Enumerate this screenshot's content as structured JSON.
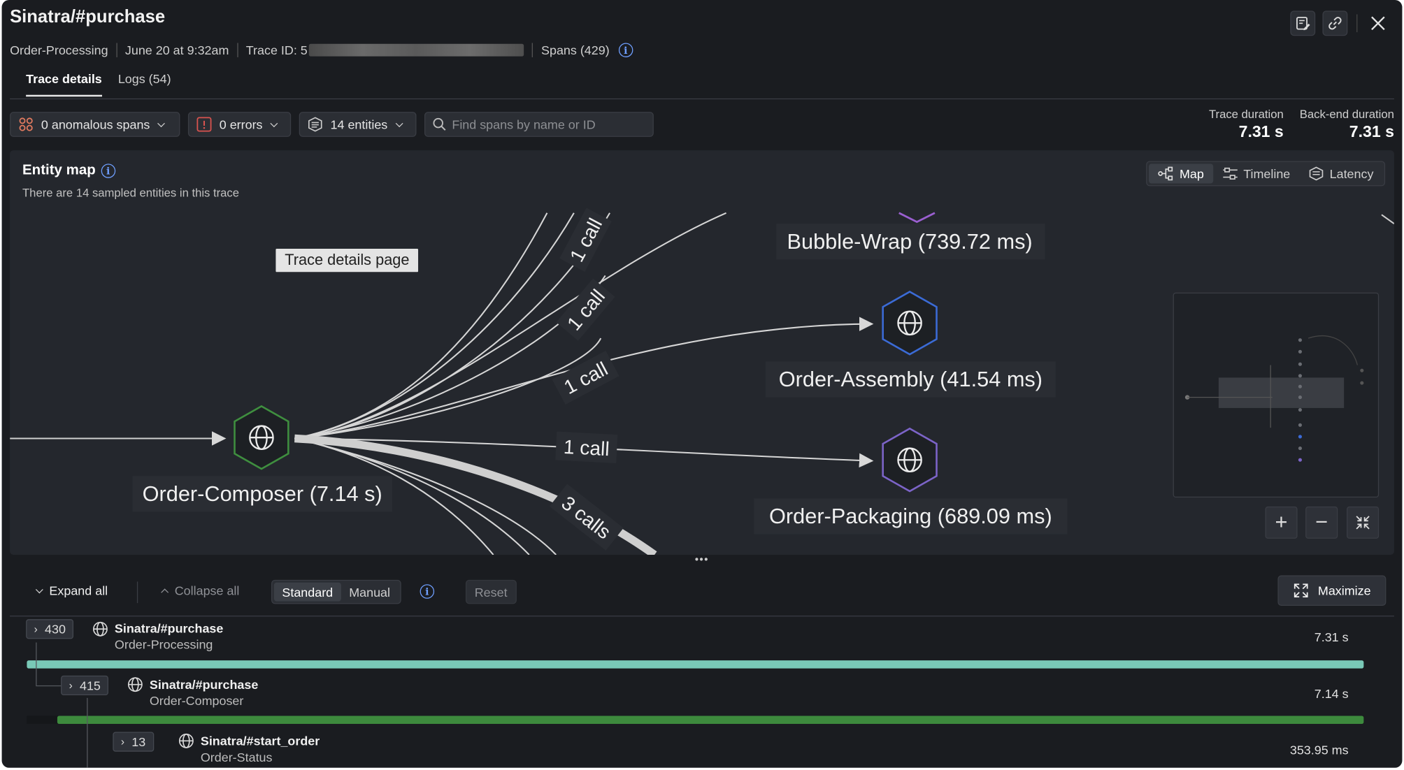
{
  "header": {
    "title": "Sinatra/#purchase",
    "service": "Order-Processing",
    "timestamp": "June 20 at 9:32am",
    "trace_id_label": "Trace ID: 5",
    "spans": "Spans (429)"
  },
  "tabs": [
    {
      "label": "Trace details",
      "active": true
    },
    {
      "label": "Logs (54)",
      "active": false
    }
  ],
  "filters": {
    "anomalous": "0 anomalous spans",
    "errors": "0 errors",
    "entities": "14 entities",
    "search_placeholder": "Find spans by name or ID"
  },
  "durations": {
    "trace_label": "Trace duration",
    "trace_value": "7.31 s",
    "backend_label": "Back-end duration",
    "backend_value": "7.31 s"
  },
  "entity_map": {
    "title": "Entity map",
    "subtitle": "There are 14 sampled entities in this trace",
    "views": [
      "Map",
      "Timeline",
      "Latency"
    ],
    "active_view": "Map",
    "tooltip": "Trace details page",
    "nodes": [
      {
        "label": "Order-Composer (7.14 s)",
        "color": "#3f8f3f"
      },
      {
        "label": "Bubble-Wrap (739.72 ms)",
        "color": "#9a5fd0"
      },
      {
        "label": "Order-Assembly (41.54 ms)",
        "color": "#3b6bd6"
      },
      {
        "label": "Order-Packaging (689.09 ms)",
        "color": "#7c64c8"
      }
    ],
    "edge_labels": [
      "1 call",
      "1 call",
      "1 call",
      "1 call",
      "3 calls"
    ]
  },
  "tree_controls": {
    "expand_all": "Expand all",
    "collapse_all": "Collapse all",
    "modes": [
      "Standard",
      "Manual"
    ],
    "active_mode": "Standard",
    "reset": "Reset",
    "maximize": "Maximize"
  },
  "spans": [
    {
      "count": "430",
      "name": "Sinatra/#purchase",
      "service": "Order-Processing",
      "duration": "7.31 s",
      "bar_color": "#79c9b7",
      "bar_start": 0.0,
      "bar_fraction": 1.0
    },
    {
      "count": "415",
      "name": "Sinatra/#purchase",
      "service": "Order-Composer",
      "duration": "7.14 s",
      "bar_color": "#3d8a3d",
      "bar_start": 0.023,
      "bar_fraction": 0.977
    },
    {
      "count": "13",
      "name": "Sinatra/#start_order",
      "service": "Order-Status",
      "duration": "353.95 ms",
      "bar_color": "#3d8a3d",
      "bar_start": 0.0,
      "bar_fraction": 0.0
    }
  ],
  "colors": {
    "background": "#1a1c20",
    "panel": "#24272d",
    "accent_info": "#6f9fff",
    "anomaly_icon": "#e07a5f",
    "error_icon": "#d9534f"
  }
}
